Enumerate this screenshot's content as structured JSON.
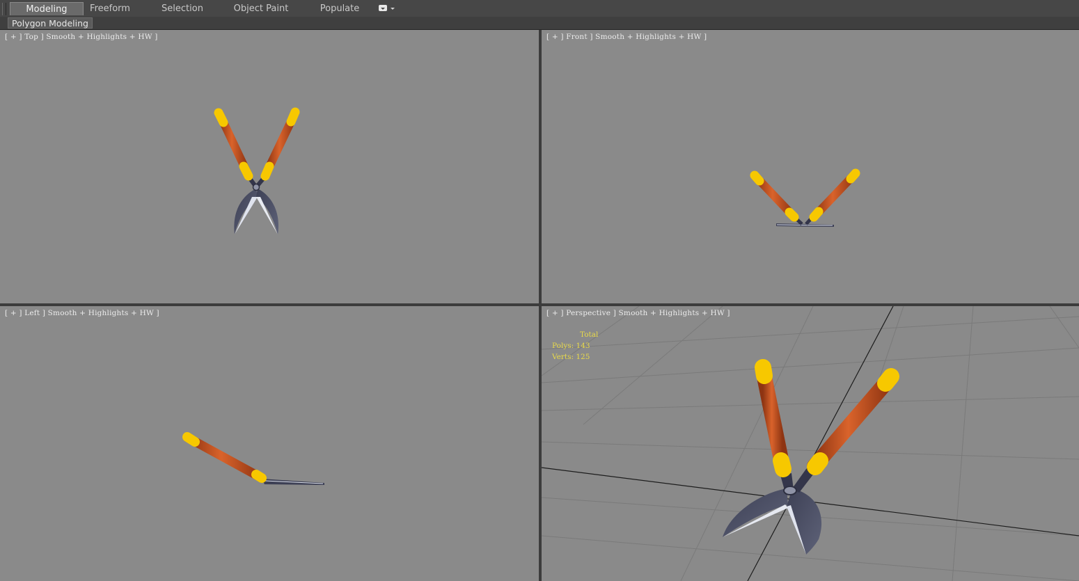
{
  "ribbon": {
    "tabs": [
      {
        "label": "Modeling",
        "active": true
      },
      {
        "label": "Freeform",
        "active": false
      },
      {
        "label": "Selection",
        "active": false
      },
      {
        "label": "Object Paint",
        "active": false
      },
      {
        "label": "Populate",
        "active": false
      }
    ],
    "menu_icon": "ribbon-options-icon"
  },
  "subpanel": {
    "label": "Polygon Modeling"
  },
  "viewports": {
    "top": {
      "label": "[ + ] Top ] Smooth + Highlights + HW ]"
    },
    "front": {
      "label": "[ + ] Front ] Smooth + Highlights + HW ]"
    },
    "left": {
      "label": "[ + ] Left ] Smooth + Highlights + HW ]"
    },
    "perspective": {
      "label": "[ + ] Perspective ] Smooth + Highlights + HW ]",
      "stats": {
        "title": "Total",
        "polys": "Polys: 143",
        "verts": "Verts: 125"
      }
    }
  },
  "colors": {
    "viewport_bg": "#8a8a8a",
    "handle": "#c4521e",
    "cap": "#f5c400",
    "blade": "#4a4d63",
    "blade_edge": "#dfe3ee",
    "stats_text": "#e8d94a"
  }
}
